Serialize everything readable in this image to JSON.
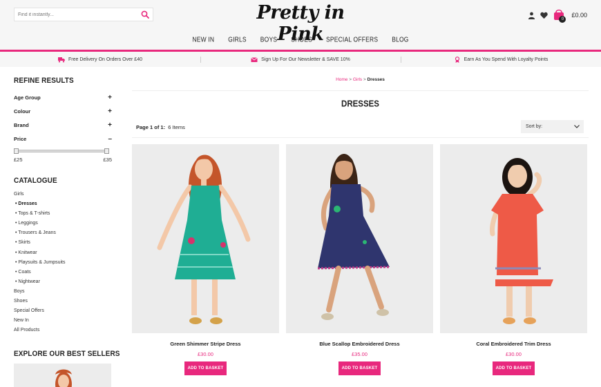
{
  "header": {
    "search_placeholder": "Find it instantly...",
    "logo": "Pretty in Pink",
    "basket_count": "0",
    "basket_total": "£0.00",
    "icons": [
      "search-icon",
      "user-icon",
      "heart-icon",
      "basket-icon"
    ]
  },
  "nav": {
    "items": [
      {
        "label": "NEW IN"
      },
      {
        "label": "GIRLS"
      },
      {
        "label": "BOYS"
      },
      {
        "label": "SHOES"
      },
      {
        "label": "SPECIAL OFFERS"
      },
      {
        "label": "BLOG"
      }
    ]
  },
  "promo": {
    "items": [
      {
        "icon": "delivery-truck-icon",
        "text": "Free Delivery On Orders Over £40"
      },
      {
        "icon": "envelope-icon",
        "text": "Sign Up For Our Newsletter & SAVE 10%"
      },
      {
        "icon": "loyalty-ribbon-icon",
        "text": "Earn As You Spend With Loyalty Points"
      }
    ]
  },
  "sidebar": {
    "refine_title": "REFINE RESULTS",
    "filters": [
      {
        "label": "Age Group",
        "toggle": "+"
      },
      {
        "label": "Colour",
        "toggle": "+"
      },
      {
        "label": "Brand",
        "toggle": "+"
      },
      {
        "label": "Price",
        "toggle": "–"
      }
    ],
    "price_min": "£25",
    "price_max": "£35",
    "catalogue_title": "CATALOGUE",
    "catalogue": [
      {
        "label": "Girls",
        "sub": false,
        "active": false
      },
      {
        "label": "• Dresses",
        "sub": true,
        "active": true
      },
      {
        "label": "• Tops & T-shirts",
        "sub": true,
        "active": false
      },
      {
        "label": "• Leggings",
        "sub": true,
        "active": false
      },
      {
        "label": "• Trousers & Jeans",
        "sub": true,
        "active": false
      },
      {
        "label": "• Skirts",
        "sub": true,
        "active": false
      },
      {
        "label": "• Knitwear",
        "sub": true,
        "active": false
      },
      {
        "label": "• Playsuits & Jumpsuits",
        "sub": true,
        "active": false
      },
      {
        "label": "• Coats",
        "sub": true,
        "active": false
      },
      {
        "label": "• Nightwear",
        "sub": true,
        "active": false
      },
      {
        "label": "Boys",
        "sub": false,
        "active": false
      },
      {
        "label": "Shoes",
        "sub": false,
        "active": false
      },
      {
        "label": "Special Offers",
        "sub": false,
        "active": false
      },
      {
        "label": "New In",
        "sub": false,
        "active": false
      },
      {
        "label": "All Products",
        "sub": false,
        "active": false
      }
    ],
    "best_sellers_title": "EXPLORE OUR BEST SELLERS"
  },
  "main": {
    "breadcrumb": {
      "home": "Home",
      "sep": ">",
      "girls": "Girls",
      "current": "Dresses"
    },
    "title": "DRESSES",
    "page_label": "Page 1 of 1:",
    "items_count": "6 Items",
    "sort_label": "Sort by:"
  },
  "products": [
    {
      "name": "Green Shimmer Stripe Dress",
      "price": "£30.00",
      "button": "ADD TO BASKET",
      "dress_color": "#1fae94",
      "hair_color": "#c4552a",
      "skin": "#f3c8a8"
    },
    {
      "name": "Blue Scallop Embroidered Dress",
      "price": "£35.00",
      "button": "ADD TO BASKET",
      "dress_color": "#2f356e",
      "hair_color": "#3b2416",
      "skin": "#d9a37d"
    },
    {
      "name": "Coral Embroidered Trim Dress",
      "price": "£30.00",
      "button": "ADD TO BASKET",
      "dress_color": "#ee5a47",
      "hair_color": "#1c1410",
      "skin": "#f0ccae"
    }
  ],
  "colors": {
    "accent": "#e8287d",
    "header_bg": "#f6f6f6"
  }
}
